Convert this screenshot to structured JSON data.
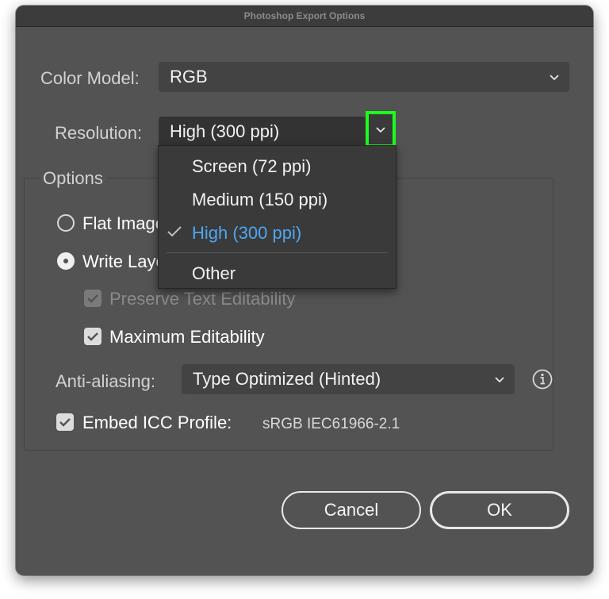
{
  "window": {
    "title": "Photoshop Export Options"
  },
  "color_model": {
    "label": "Color Model:",
    "value": "RGB"
  },
  "resolution": {
    "label": "Resolution:",
    "value": "High (300 ppi)",
    "options": [
      "Screen (72 ppi)",
      "Medium (150 ppi)",
      "High (300 ppi)",
      "Other"
    ],
    "selected_index": 2
  },
  "options_group": {
    "title": "Options",
    "flat_image_label": "Flat Image",
    "write_layers_label": "Write Layers",
    "preserve_text_label": "Preserve Text Editability",
    "max_editability_label": "Maximum Editability"
  },
  "anti_aliasing": {
    "label": "Anti-aliasing:",
    "value": "Type Optimized (Hinted)"
  },
  "icc": {
    "label": "Embed ICC Profile:",
    "value": "sRGB IEC61966-2.1"
  },
  "buttons": {
    "cancel": "Cancel",
    "ok": "OK"
  },
  "colors": {
    "accent": "#4fa6f2",
    "highlight": "#1cff1c",
    "dialog_bg": "#535353"
  }
}
